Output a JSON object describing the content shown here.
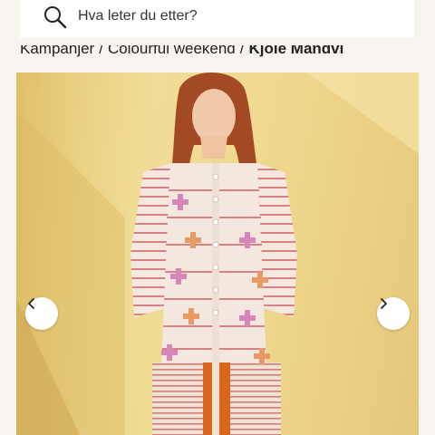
{
  "search": {
    "placeholder": "Hva leter du etter?",
    "icon": "search-icon"
  },
  "breadcrumb": {
    "items": [
      "Kampanjer",
      "Colourful weekend"
    ],
    "separator": "/",
    "current": "Kjole Mandvi"
  },
  "gallery": {
    "image": "product-photo-dress",
    "prev_icon": "chevron-left-icon",
    "next_icon": "chevron-right-icon"
  },
  "colors": {
    "background": "#f7f3ee",
    "wall": "#efd98f",
    "dress": "#f3e7df",
    "stripe": "#d98080",
    "orange": "#d9661d"
  }
}
